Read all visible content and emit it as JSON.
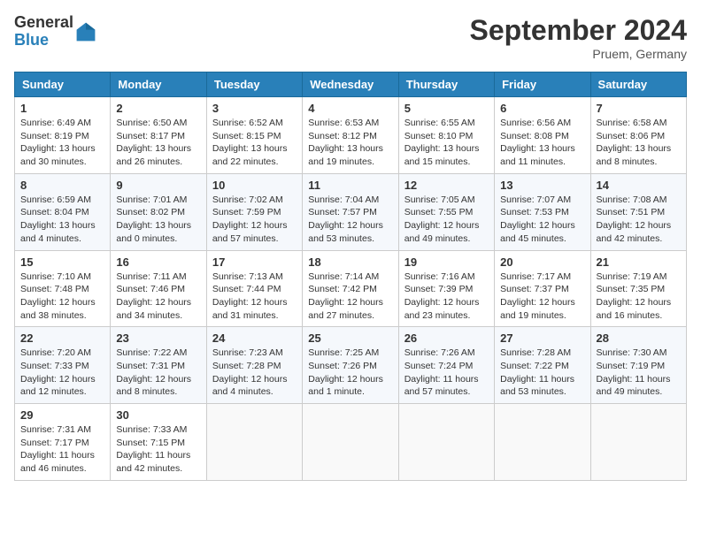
{
  "header": {
    "logo_general": "General",
    "logo_blue": "Blue",
    "title": "September 2024",
    "location": "Pruem, Germany"
  },
  "days_of_week": [
    "Sunday",
    "Monday",
    "Tuesday",
    "Wednesday",
    "Thursday",
    "Friday",
    "Saturday"
  ],
  "weeks": [
    [
      {
        "day": 1,
        "content": "Sunrise: 6:49 AM\nSunset: 8:19 PM\nDaylight: 13 hours and 30 minutes."
      },
      {
        "day": 2,
        "content": "Sunrise: 6:50 AM\nSunset: 8:17 PM\nDaylight: 13 hours and 26 minutes."
      },
      {
        "day": 3,
        "content": "Sunrise: 6:52 AM\nSunset: 8:15 PM\nDaylight: 13 hours and 22 minutes."
      },
      {
        "day": 4,
        "content": "Sunrise: 6:53 AM\nSunset: 8:12 PM\nDaylight: 13 hours and 19 minutes."
      },
      {
        "day": 5,
        "content": "Sunrise: 6:55 AM\nSunset: 8:10 PM\nDaylight: 13 hours and 15 minutes."
      },
      {
        "day": 6,
        "content": "Sunrise: 6:56 AM\nSunset: 8:08 PM\nDaylight: 13 hours and 11 minutes."
      },
      {
        "day": 7,
        "content": "Sunrise: 6:58 AM\nSunset: 8:06 PM\nDaylight: 13 hours and 8 minutes."
      }
    ],
    [
      {
        "day": 8,
        "content": "Sunrise: 6:59 AM\nSunset: 8:04 PM\nDaylight: 13 hours and 4 minutes."
      },
      {
        "day": 9,
        "content": "Sunrise: 7:01 AM\nSunset: 8:02 PM\nDaylight: 13 hours and 0 minutes."
      },
      {
        "day": 10,
        "content": "Sunrise: 7:02 AM\nSunset: 7:59 PM\nDaylight: 12 hours and 57 minutes."
      },
      {
        "day": 11,
        "content": "Sunrise: 7:04 AM\nSunset: 7:57 PM\nDaylight: 12 hours and 53 minutes."
      },
      {
        "day": 12,
        "content": "Sunrise: 7:05 AM\nSunset: 7:55 PM\nDaylight: 12 hours and 49 minutes."
      },
      {
        "day": 13,
        "content": "Sunrise: 7:07 AM\nSunset: 7:53 PM\nDaylight: 12 hours and 45 minutes."
      },
      {
        "day": 14,
        "content": "Sunrise: 7:08 AM\nSunset: 7:51 PM\nDaylight: 12 hours and 42 minutes."
      }
    ],
    [
      {
        "day": 15,
        "content": "Sunrise: 7:10 AM\nSunset: 7:48 PM\nDaylight: 12 hours and 38 minutes."
      },
      {
        "day": 16,
        "content": "Sunrise: 7:11 AM\nSunset: 7:46 PM\nDaylight: 12 hours and 34 minutes."
      },
      {
        "day": 17,
        "content": "Sunrise: 7:13 AM\nSunset: 7:44 PM\nDaylight: 12 hours and 31 minutes."
      },
      {
        "day": 18,
        "content": "Sunrise: 7:14 AM\nSunset: 7:42 PM\nDaylight: 12 hours and 27 minutes."
      },
      {
        "day": 19,
        "content": "Sunrise: 7:16 AM\nSunset: 7:39 PM\nDaylight: 12 hours and 23 minutes."
      },
      {
        "day": 20,
        "content": "Sunrise: 7:17 AM\nSunset: 7:37 PM\nDaylight: 12 hours and 19 minutes."
      },
      {
        "day": 21,
        "content": "Sunrise: 7:19 AM\nSunset: 7:35 PM\nDaylight: 12 hours and 16 minutes."
      }
    ],
    [
      {
        "day": 22,
        "content": "Sunrise: 7:20 AM\nSunset: 7:33 PM\nDaylight: 12 hours and 12 minutes."
      },
      {
        "day": 23,
        "content": "Sunrise: 7:22 AM\nSunset: 7:31 PM\nDaylight: 12 hours and 8 minutes."
      },
      {
        "day": 24,
        "content": "Sunrise: 7:23 AM\nSunset: 7:28 PM\nDaylight: 12 hours and 4 minutes."
      },
      {
        "day": 25,
        "content": "Sunrise: 7:25 AM\nSunset: 7:26 PM\nDaylight: 12 hours and 1 minute."
      },
      {
        "day": 26,
        "content": "Sunrise: 7:26 AM\nSunset: 7:24 PM\nDaylight: 11 hours and 57 minutes."
      },
      {
        "day": 27,
        "content": "Sunrise: 7:28 AM\nSunset: 7:22 PM\nDaylight: 11 hours and 53 minutes."
      },
      {
        "day": 28,
        "content": "Sunrise: 7:30 AM\nSunset: 7:19 PM\nDaylight: 11 hours and 49 minutes."
      }
    ],
    [
      {
        "day": 29,
        "content": "Sunrise: 7:31 AM\nSunset: 7:17 PM\nDaylight: 11 hours and 46 minutes."
      },
      {
        "day": 30,
        "content": "Sunrise: 7:33 AM\nSunset: 7:15 PM\nDaylight: 11 hours and 42 minutes."
      },
      {
        "day": null,
        "content": ""
      },
      {
        "day": null,
        "content": ""
      },
      {
        "day": null,
        "content": ""
      },
      {
        "day": null,
        "content": ""
      },
      {
        "day": null,
        "content": ""
      }
    ]
  ]
}
